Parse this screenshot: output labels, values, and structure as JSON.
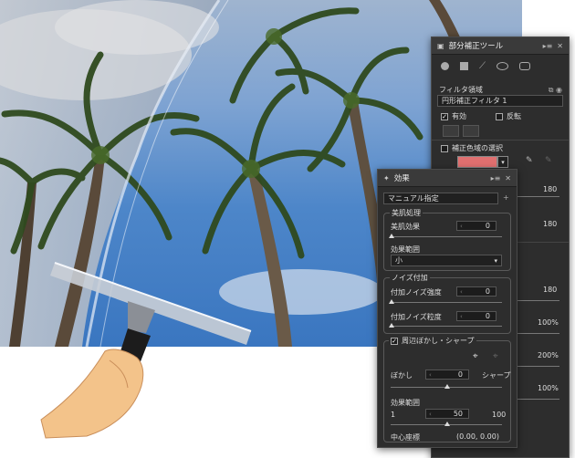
{
  "panel_back": {
    "title": "部分補正ツール",
    "region_label": "フィルタ領域",
    "filter_select": "円形補正フィルタ 1",
    "enabled_label": "有効",
    "invert_label": "反転",
    "color_select_label": "補正色域の選択",
    "swatch_color": "#e07070",
    "right_values": [
      "180",
      "180",
      "180",
      "100%",
      "200%",
      "100%"
    ]
  },
  "panel_front": {
    "title": "効果",
    "mode_select": "マニュアル指定",
    "skin_group": "美肌処理",
    "skin_effect_label": "美肌効果",
    "skin_effect_value": "0",
    "effect_range_label": "効果範囲",
    "effect_range_value": "小",
    "noise_group": "ノイズ付加",
    "noise_strength_label": "付加ノイズ強度",
    "noise_strength_value": "0",
    "noise_grain_label": "付加ノイズ粒度",
    "noise_grain_value": "0",
    "periph_group": "周辺ぼかし・シャープ",
    "blur_label": "ぼかし",
    "blur_value": "0",
    "sharp_label": "シャープ",
    "range_label": "効果範囲",
    "range_min": "1",
    "range_value": "50",
    "range_max": "100",
    "center_label": "中心座標",
    "center_value": "(0.00, 0.00)"
  }
}
